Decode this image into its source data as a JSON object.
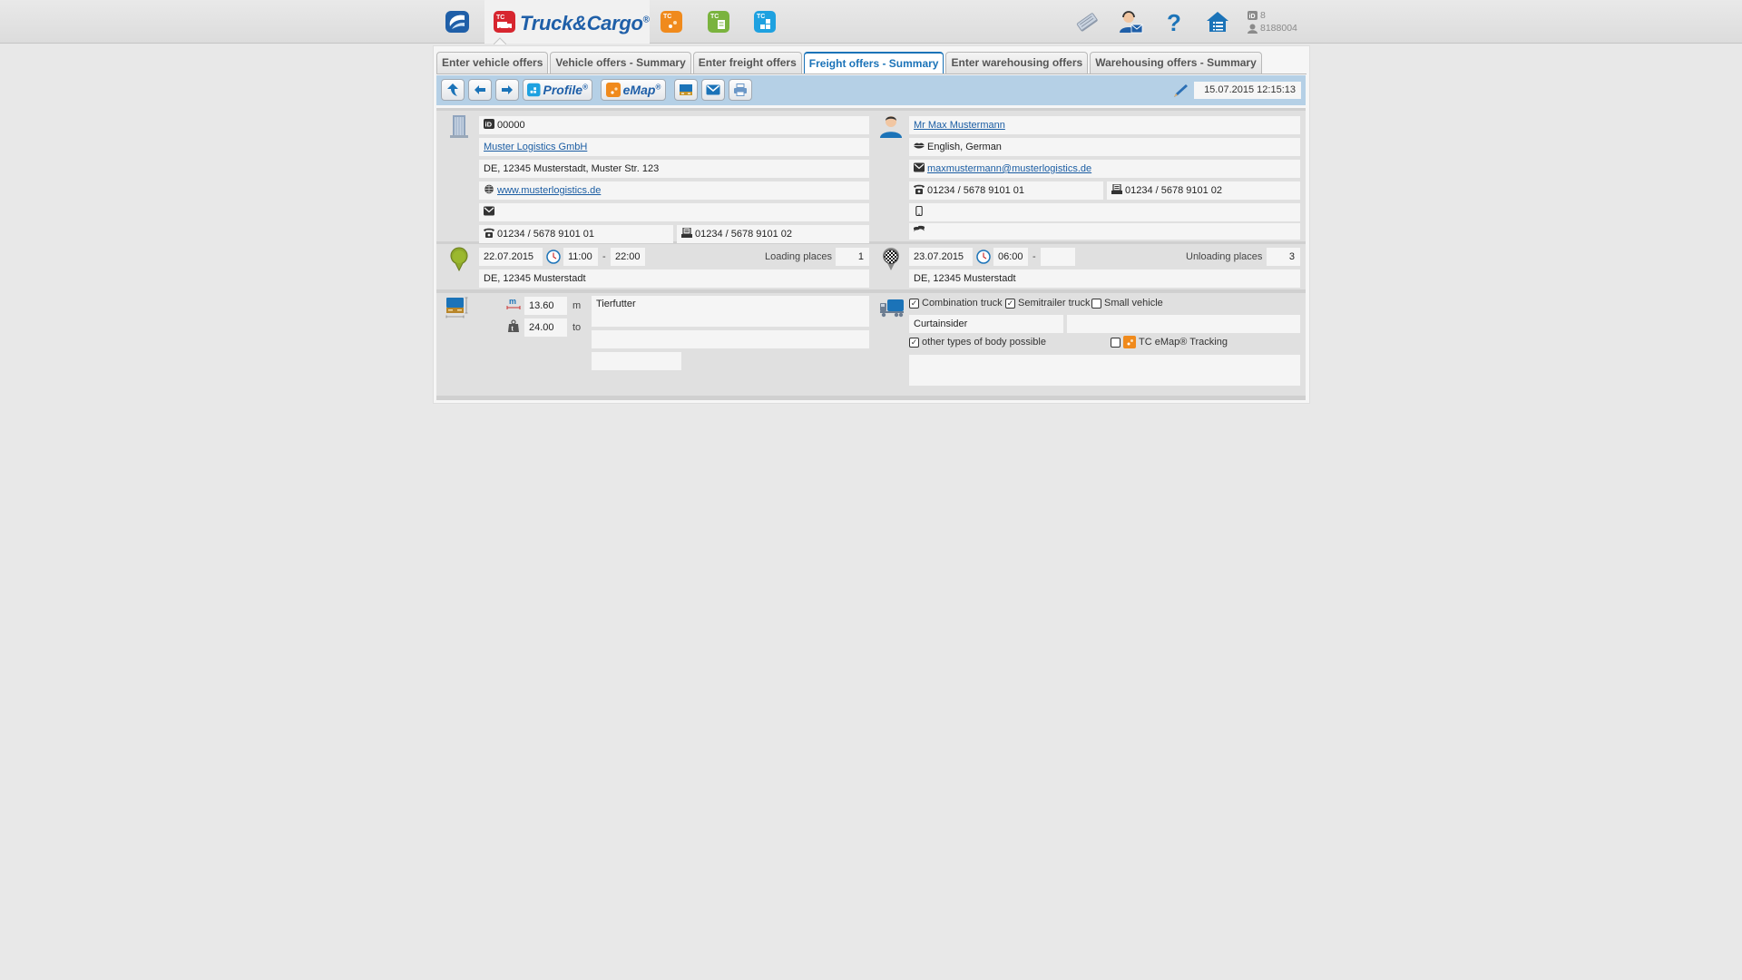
{
  "topbar": {
    "logo_text": "Truck&Cargo",
    "logo_reg": "®",
    "apps": [
      {
        "name": "home-app",
        "color": "#1f5fa8"
      },
      {
        "name": "tc-emap-app",
        "color": "#f08a1c"
      },
      {
        "name": "tc-invoice-app",
        "color": "#7ab33e"
      },
      {
        "name": "tc-profile-app",
        "color": "#1ea1e0"
      }
    ],
    "user_id_count": "8",
    "user_number": "8188004"
  },
  "tabs": [
    {
      "label": "Enter vehicle offers",
      "active": false
    },
    {
      "label": "Vehicle offers - Summary",
      "active": false
    },
    {
      "label": "Enter freight offers",
      "active": false
    },
    {
      "label": "Freight offers - Summary",
      "active": true
    },
    {
      "label": "Enter warehousing offers",
      "active": false
    },
    {
      "label": "Warehousing offers - Summary",
      "active": false
    }
  ],
  "toolbar": {
    "profile_label": "Profile",
    "emap_label": "eMap",
    "reg": "®",
    "timestamp": "15.07.2015 12:15:13"
  },
  "company": {
    "id": "00000",
    "name": "Muster Logistics GmbH",
    "address": "DE, 12345 Musterstadt, Muster Str. 123",
    "website": "www.musterlogistics.de",
    "email": "",
    "phone": "01234 / 5678 9101 01",
    "fax": "01234 / 5678 9101 02"
  },
  "contact": {
    "name": "Mr Max Mustermann",
    "languages": "English, German",
    "email": "maxmustermann@musterlogistics.de",
    "phone": "01234 / 5678 9101 01",
    "fax": "01234 / 5678 9101 02",
    "mobile": "",
    "messenger": ""
  },
  "loading": {
    "date": "22.07.2015",
    "time_from": "11:00",
    "dash": "-",
    "time_to": "22:00",
    "places_label": "Loading places",
    "places": "1",
    "location": "DE, 12345 Musterstadt"
  },
  "unloading": {
    "date": "23.07.2015",
    "time_from": "06:00",
    "dash": "-",
    "time_to": "",
    "places_label": "Unloading places",
    "places": "3",
    "location": "DE, 12345 Musterstadt"
  },
  "cargo": {
    "length": "13.60",
    "length_unit": "m",
    "weight": "24.00",
    "weight_unit": "to",
    "description": "Tierfutter",
    "description2": "",
    "extra": ""
  },
  "vehicle": {
    "types": [
      {
        "label": "Combination truck",
        "checked": true
      },
      {
        "label": "Semitrailer truck",
        "checked": true
      },
      {
        "label": "Small vehicle",
        "checked": false
      }
    ],
    "body": "Curtainsider",
    "body2": "",
    "other_body_label": "other types of body possible",
    "other_body_checked": true,
    "tracking_label": "TC eMap® Tracking",
    "tracking_checked": false,
    "notes": ""
  }
}
